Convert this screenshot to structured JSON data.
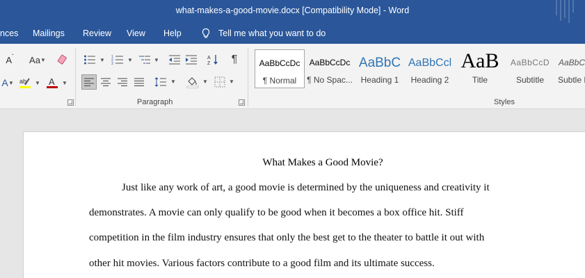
{
  "titlebar": {
    "title": "what-makes-a-good-movie.docx [Compatibility Mode]  -  Word"
  },
  "menu": {
    "tabs": [
      "nces",
      "Mailings",
      "Review",
      "View",
      "Help"
    ],
    "tell_me": "Tell me what you want to do"
  },
  "ribbon": {
    "font_size_btn": "Aa",
    "paragraph_label": "Paragraph",
    "styles_label": "Styles",
    "pilcrow": "¶",
    "styles": [
      {
        "sample": "AaBbCcDc",
        "name": "¶ Normal"
      },
      {
        "sample": "AaBbCcDc",
        "name": "¶ No Spac..."
      },
      {
        "sample": "AaBbC",
        "name": "Heading 1"
      },
      {
        "sample": "AaBbCcl",
        "name": "Heading 2"
      },
      {
        "sample": "AaB",
        "name": "Title"
      },
      {
        "sample": "AaBbCcD",
        "name": "Subtitle"
      },
      {
        "sample": "AaBbC",
        "name": "Subtle E"
      }
    ]
  },
  "document": {
    "title": "What Makes a Good Movie?",
    "lines": [
      "Just like any work of art, a good movie is determined by the uniqueness and creativity it",
      "demonstrates. A movie can only qualify to be good when it becomes a box office hit. Stiff",
      "competition in the film industry ensures that only the best get to the theater to battle it out with",
      "other hit movies. Various factors contribute to a good film and its ultimate success."
    ]
  },
  "colors": {
    "brand": "#2b579a",
    "highlight": "#ffff00",
    "font_color": "#c00000",
    "heading": "#2e74b5"
  }
}
